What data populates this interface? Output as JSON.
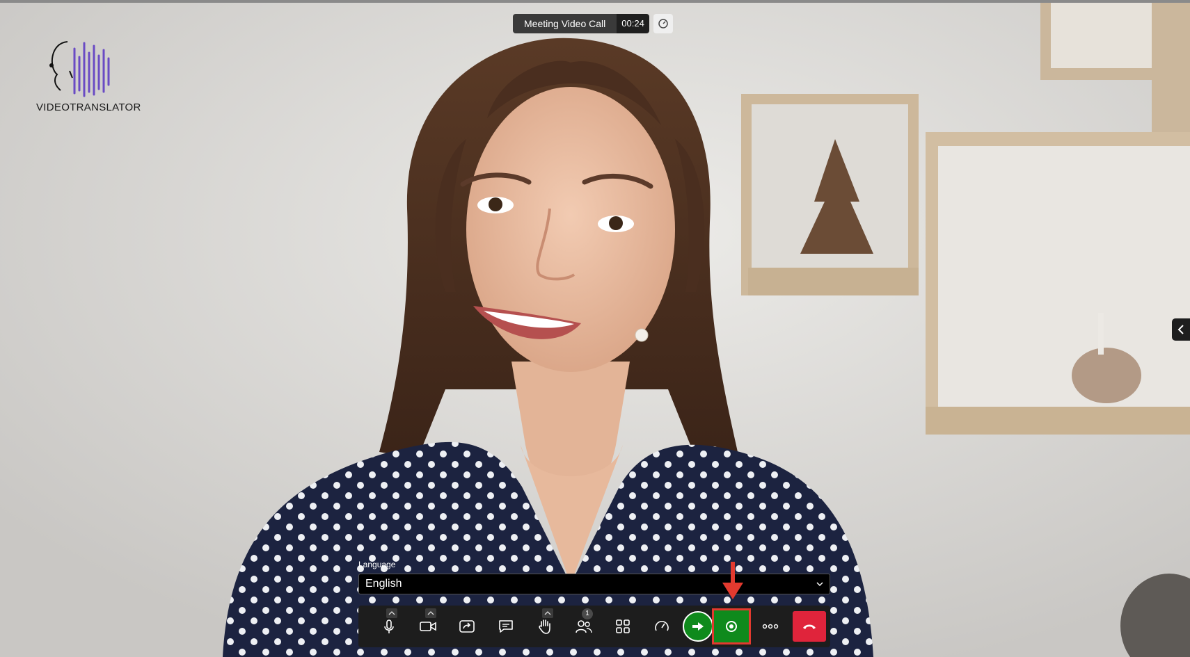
{
  "app": {
    "logo_text": "VIDEOTRANSLATOR"
  },
  "meeting": {
    "title": "Meeting Video Call",
    "timer": "00:24"
  },
  "language": {
    "label": "Language",
    "selected": "English"
  },
  "toolbar": {
    "participants_count": "1",
    "buttons": [
      {
        "name": "microphone",
        "icon": "microphone-icon"
      },
      {
        "name": "camera",
        "icon": "video-camera-icon"
      },
      {
        "name": "share-screen",
        "icon": "share-screen-icon"
      },
      {
        "name": "chat",
        "icon": "chat-bubble-icon"
      },
      {
        "name": "raise-hand",
        "icon": "hand-icon"
      },
      {
        "name": "participants",
        "icon": "people-icon"
      },
      {
        "name": "layout",
        "icon": "grid-icon"
      },
      {
        "name": "performance",
        "icon": "speedometer-icon"
      },
      {
        "name": "translate",
        "icon": "arrow-right-icon"
      },
      {
        "name": "record",
        "icon": "record-icon"
      },
      {
        "name": "more",
        "icon": "more-dots-icon"
      },
      {
        "name": "hang-up",
        "icon": "phone-hangup-icon"
      }
    ]
  },
  "colors": {
    "accent_green": "#0f8a1c",
    "hangup_red": "#e0243b",
    "highlight_red": "#e33a2f",
    "toolbar_bg": "#1d1d1d",
    "logo_purple": "#6a4bc4"
  }
}
